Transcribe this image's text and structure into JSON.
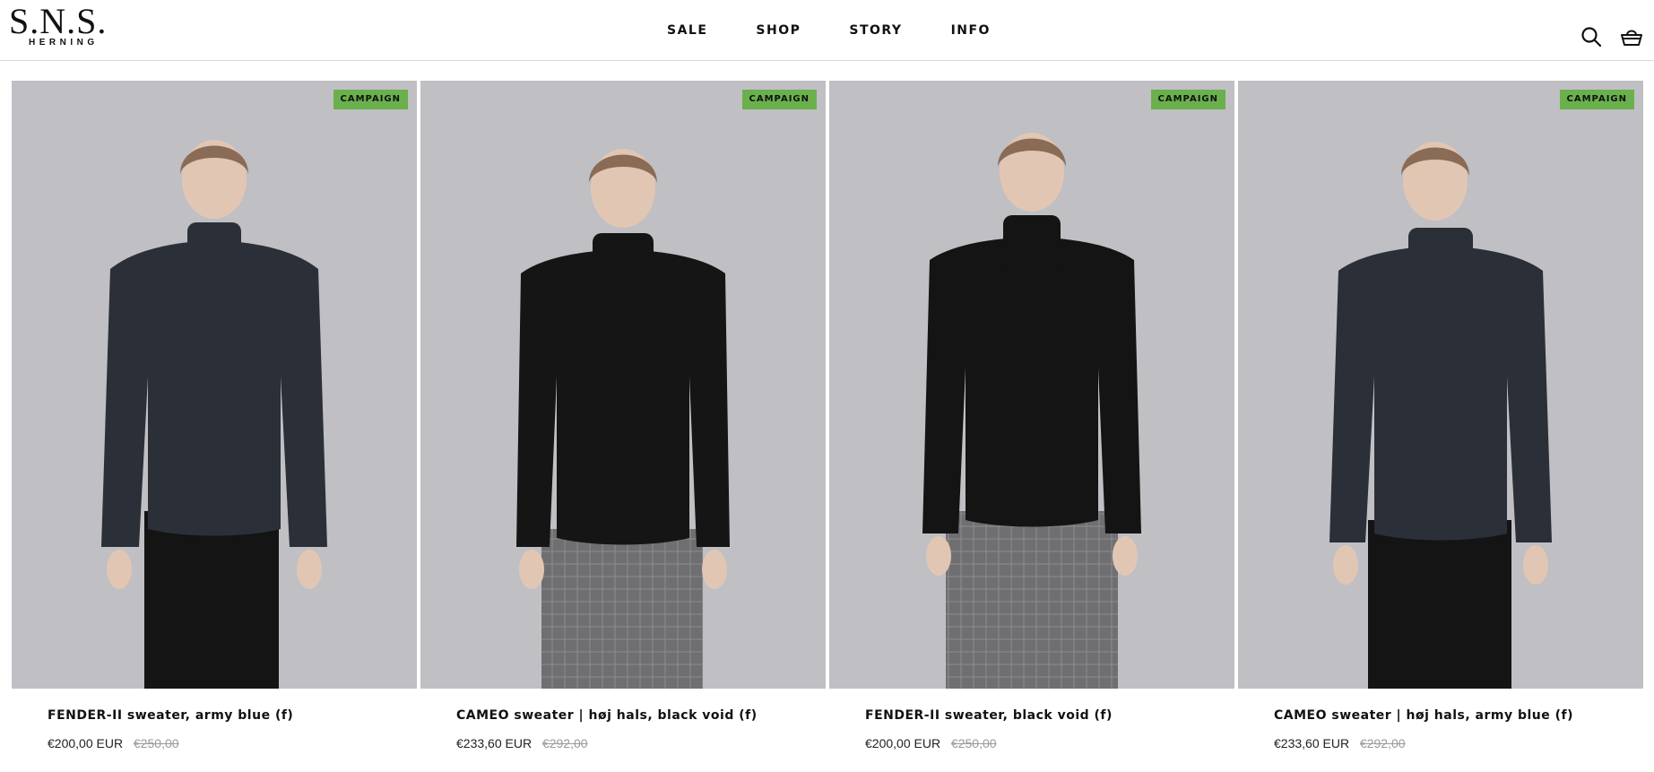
{
  "header": {
    "logo_main": "S.N.S.",
    "logo_sub": "HERNING",
    "nav": [
      "SALE",
      "SHOP",
      "STORY",
      "INFO"
    ]
  },
  "icons": {
    "search": "search-icon",
    "cart": "basket-icon"
  },
  "colors": {
    "badge": "#6ab04c",
    "image_bg": "#bdbcc0",
    "old_price": "#9a9a9a"
  },
  "products": [
    {
      "badge": "CAMPAIGN",
      "title": "FENDER-II sweater, army blue (f)",
      "price": "€200,00 EUR",
      "old_price": "€250,00",
      "sweater_color": "#2b3038",
      "pants": "black"
    },
    {
      "badge": "CAMPAIGN",
      "title": "CAMEO sweater | høj hals, black void (f)",
      "price": "€233,60 EUR",
      "old_price": "€292,00",
      "sweater_color": "#151515",
      "pants": "grey-check"
    },
    {
      "badge": "CAMPAIGN",
      "title": "FENDER-II sweater, black void (f)",
      "price": "€200,00 EUR",
      "old_price": "€250,00",
      "sweater_color": "#141414",
      "pants": "grey-check"
    },
    {
      "badge": "CAMPAIGN",
      "title": "CAMEO sweater | høj hals, army blue (f)",
      "price": "€233,60 EUR",
      "old_price": "€292,00",
      "sweater_color": "#2a2f38",
      "pants": "black"
    }
  ]
}
